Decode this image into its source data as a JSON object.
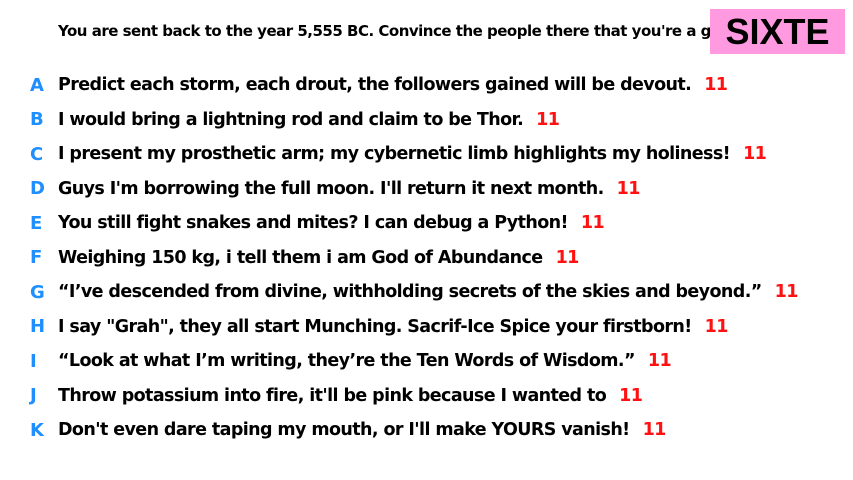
{
  "prompt": "You are sent back to the year 5,555 BC. Convince the people there that you're a god.",
  "badge": {
    "label": "SIXTE",
    "color": "#ff99e0"
  },
  "colors": {
    "letter": "#1f8fff",
    "score": "#ff1111",
    "text": "#000000"
  },
  "answers": [
    {
      "letter": "A",
      "text": "Predict each storm, each drout, the followers gained will be devout.",
      "score": "11"
    },
    {
      "letter": "B",
      "text": "I would bring a lightning rod and claim to be Thor.",
      "score": "11"
    },
    {
      "letter": "C",
      "text": "I present my prosthetic arm; my cybernetic limb highlights my holiness!",
      "score": "11"
    },
    {
      "letter": "D",
      "text": "Guys I'm borrowing the full moon. I'll return it next month.",
      "score": "11"
    },
    {
      "letter": "E",
      "text": "You still fight snakes and mites? I can debug a Python!",
      "score": "11"
    },
    {
      "letter": "F",
      "text": "Weighing 150 kg, i tell them i am God of Abundance",
      "score": "11"
    },
    {
      "letter": "G",
      "text": "“I’ve descended from divine, withholding secrets of the skies and beyond.”",
      "score": "11"
    },
    {
      "letter": "H",
      "text": "I say \"Grah\", they all start Munching. Sacrif-Ice Spice your firstborn!",
      "score": "11"
    },
    {
      "letter": "I",
      "text": "“Look at what I’m writing, they’re the Ten Words of Wisdom.”",
      "score": "11"
    },
    {
      "letter": "J",
      "text": "Throw potassium into fire, it'll be pink because I wanted to",
      "score": "11"
    },
    {
      "letter": "K",
      "text": "Don't even dare taping my mouth, or I'll make YOURS vanish!",
      "score": "11"
    }
  ]
}
